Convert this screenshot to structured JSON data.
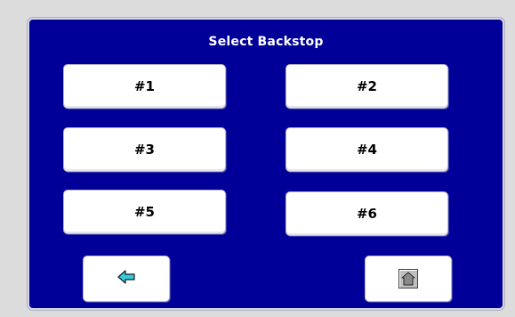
{
  "title": "Select Backstop",
  "buttons": [
    "#1",
    "#2",
    "#3",
    "#4",
    "#5",
    "#6"
  ],
  "nav": {
    "back_icon": "arrow-left-icon",
    "home_icon": "home-icon"
  },
  "colors": {
    "panel": "#000099",
    "button": "#ffffff",
    "arrow": "#33ccdd"
  }
}
